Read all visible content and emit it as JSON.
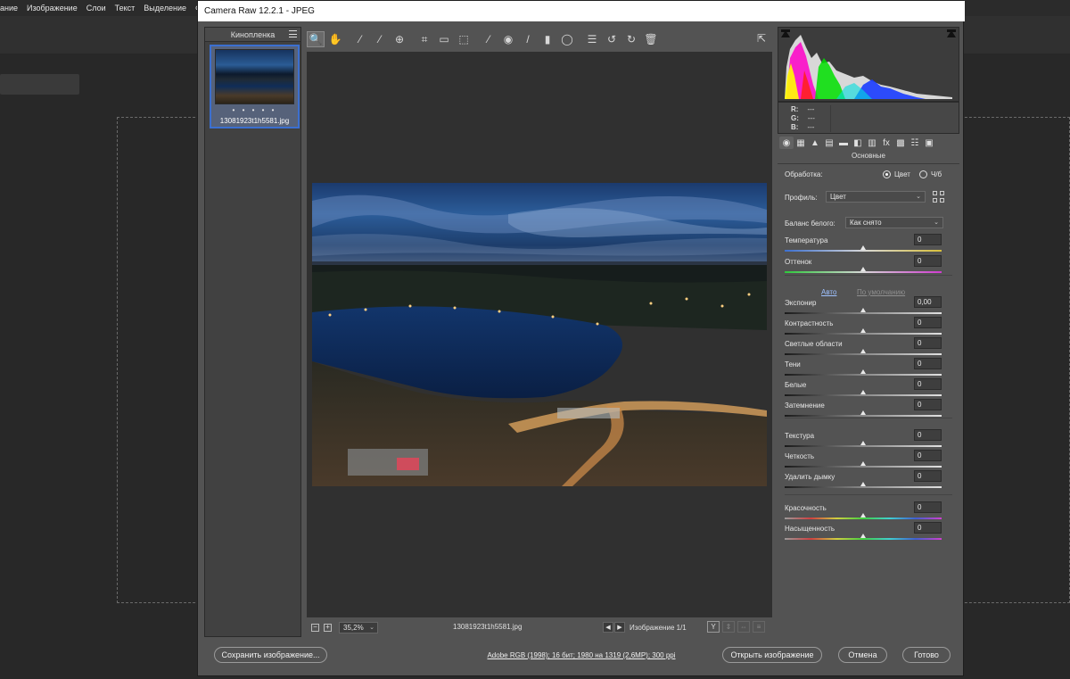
{
  "ps_menu": [
    "ание",
    "Изображение",
    "Слои",
    "Текст",
    "Выделение",
    "Фил"
  ],
  "dialog": {
    "title": "Camera Raw 12.2.1  -  JPEG"
  },
  "filmstrip": {
    "header": "Кинопленка",
    "thumb_rating": "• • • • •",
    "thumb_filename": "13081923t1h5581.jpg"
  },
  "toolbar": {
    "tools": [
      {
        "name": "zoom-tool",
        "glyph": "🔍",
        "active": true
      },
      {
        "name": "hand-tool",
        "glyph": "✋",
        "active": false,
        "gap": true
      },
      {
        "name": "white-balance-tool",
        "glyph": "⁄",
        "active": false
      },
      {
        "name": "color-sampler-tool",
        "glyph": "⁄",
        "active": false
      },
      {
        "name": "targeted-adjustment-tool",
        "glyph": "⊕",
        "active": false,
        "gap": true
      },
      {
        "name": "crop-tool",
        "glyph": "⌗",
        "active": false
      },
      {
        "name": "straighten-tool",
        "glyph": "▭",
        "active": false
      },
      {
        "name": "transform-tool",
        "glyph": "⬚",
        "active": false,
        "gap": true
      },
      {
        "name": "spot-removal-tool",
        "glyph": "⁄",
        "active": false
      },
      {
        "name": "red-eye-tool",
        "glyph": "◉",
        "active": false
      },
      {
        "name": "adjustment-brush-tool",
        "glyph": "/",
        "active": false
      },
      {
        "name": "graduated-filter-tool",
        "glyph": "▮",
        "active": false
      },
      {
        "name": "radial-filter-tool",
        "glyph": "◯",
        "active": false,
        "gap": true
      },
      {
        "name": "preferences-tool",
        "glyph": "☰",
        "active": false
      },
      {
        "name": "rotate-left-tool",
        "glyph": "↺",
        "active": false
      },
      {
        "name": "rotate-right-tool",
        "glyph": "↻",
        "active": false
      },
      {
        "name": "delete-tool",
        "glyph": "🗑",
        "active": false
      }
    ],
    "fullscreen_glyph": "⇱"
  },
  "preview_bar": {
    "zoom_minus": "−",
    "zoom_plus": "+",
    "zoom_value": "35,2%",
    "filename": "13081923t1h5581.jpg",
    "nav_prev": "◀",
    "nav_next": "▶",
    "counter": "Изображение 1/1",
    "view_buttons": [
      "Y",
      "⇕",
      "⇔",
      "≡"
    ]
  },
  "readout": {
    "r_label": "R:",
    "r_value": "---",
    "g_label": "G:",
    "g_value": "---",
    "b_label": "B:",
    "b_value": "---"
  },
  "panel_tabs": [
    "◉",
    "▦",
    "▲",
    "▤",
    "▬",
    "◧",
    "▥",
    "fx",
    "▩",
    "☷",
    "▣"
  ],
  "basic": {
    "title": "Основные",
    "treatment_label": "Обработка:",
    "treatment_color": "Цвет",
    "treatment_bw": "Ч/б",
    "profile_label": "Профиль:",
    "profile_value": "Цвет",
    "wb_label": "Баланс белого:",
    "wb_value": "Как снято",
    "auto_link": "Авто",
    "default_link": "По умолчанию",
    "sliders": [
      {
        "label": "Температура",
        "value": "0",
        "track": "temp"
      },
      {
        "label": "Оттенок",
        "value": "0",
        "track": "tint"
      },
      {
        "label": "Экспонир",
        "value": "0,00",
        "track": "neutral"
      },
      {
        "label": "Контрастность",
        "value": "0",
        "track": "neutral"
      },
      {
        "label": "Светлые области",
        "value": "0",
        "track": "neutral"
      },
      {
        "label": "Тени",
        "value": "0",
        "track": "neutral"
      },
      {
        "label": "Белые",
        "value": "0",
        "track": "neutral"
      },
      {
        "label": "Затемнение",
        "value": "0",
        "track": "neutral"
      },
      {
        "label": "Текстура",
        "value": "0",
        "track": "neutral"
      },
      {
        "label": "Четкость",
        "value": "0",
        "track": "neutral"
      },
      {
        "label": "Удалить дымку",
        "value": "0",
        "track": "neutral"
      },
      {
        "label": "Красочность",
        "value": "0",
        "track": "vibrance"
      },
      {
        "label": "Насыщенность",
        "value": "0",
        "track": "vibrance"
      }
    ]
  },
  "footer": {
    "save_label": "Сохранить изображение...",
    "info": "Adobe RGB (1998); 16 бит; 1980 на 1319 (2,6MP); 300 ppi",
    "open_label": "Открыть изображение",
    "cancel_label": "Отмена",
    "done_label": "Готово"
  }
}
